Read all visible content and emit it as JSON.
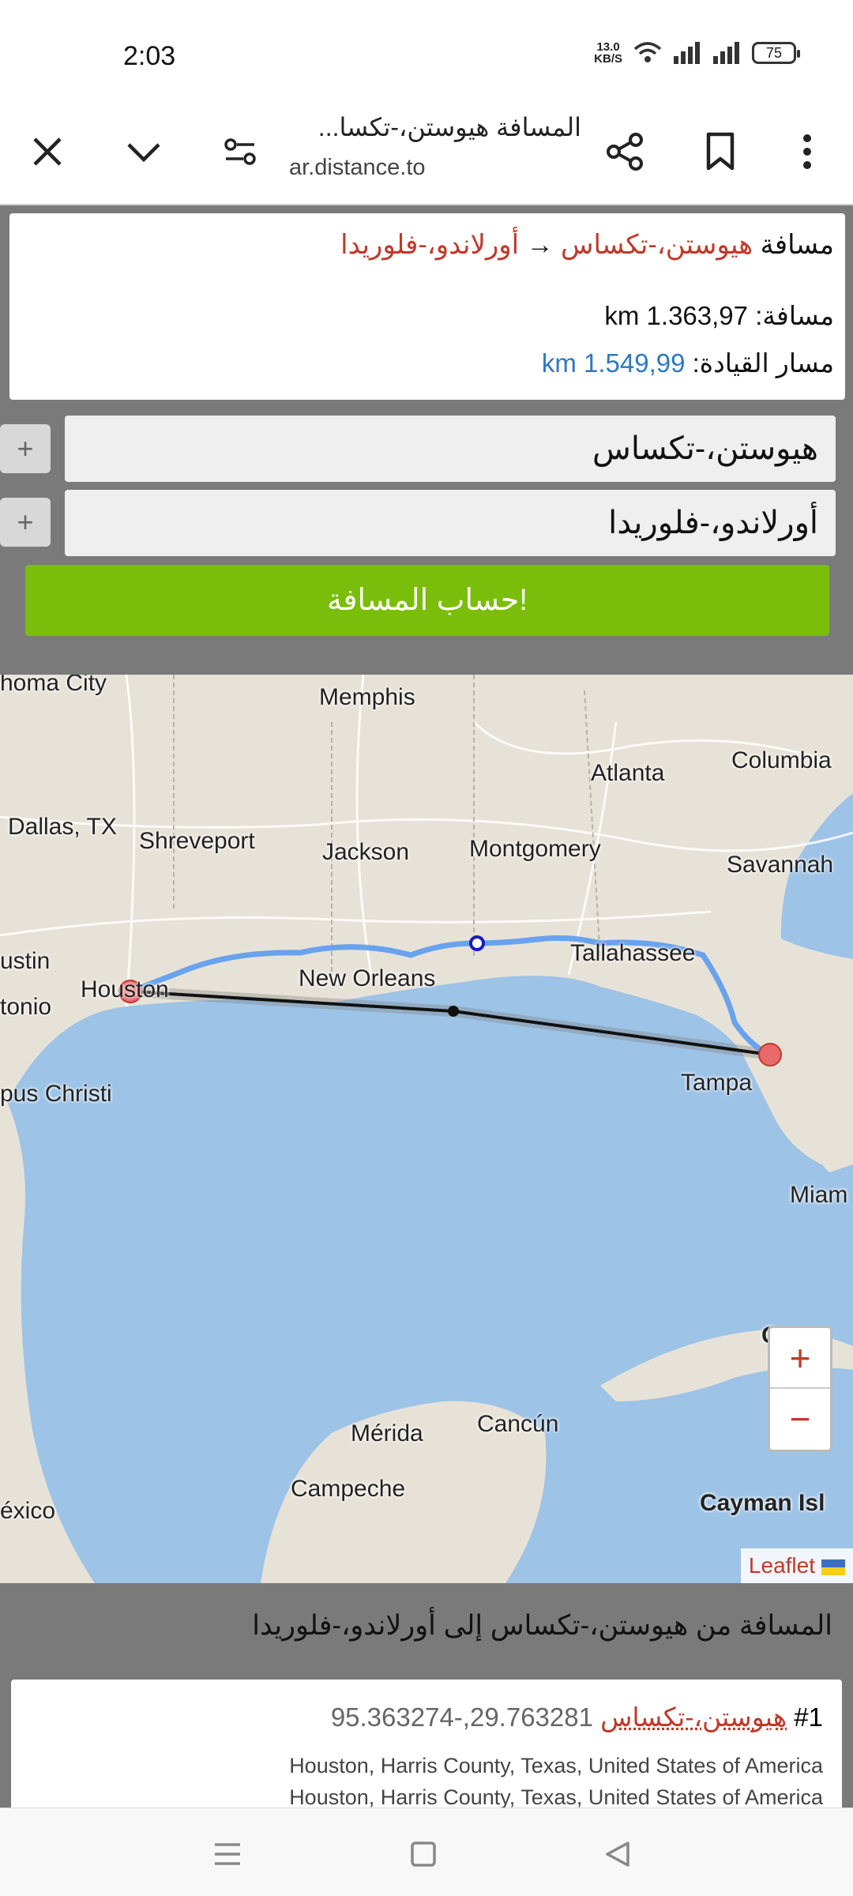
{
  "status": {
    "time": "2:03",
    "net_speed_value": "13.0",
    "net_speed_unit": "KB/S",
    "battery": "75"
  },
  "browser": {
    "title": "المسافة هيوستن،-تكسا...",
    "url": "ar.distance.to"
  },
  "summary": {
    "prefix": "مسافة",
    "from": "هيوستن،-تكساس",
    "arrow": "→",
    "to": "أورلاندو،-فلوريدا",
    "distance_label": "مسافة:",
    "distance_value": "km 1.363,97",
    "driving_label": "مسار القيادة:",
    "driving_value": "km 1.549,99"
  },
  "form": {
    "from_value": "هيوستن،-تكساس",
    "to_value": "أورلاندو،-فلوريدا",
    "plus": "+",
    "submit_label": "حساب المسافة!"
  },
  "map": {
    "labels": {
      "oklahoma": "homa City",
      "memphis": "Memphis",
      "atlanta": "Atlanta",
      "columbia": "Columbia",
      "dallas": "Dallas, TX",
      "shreveport": "Shreveport",
      "jackson": "Jackson",
      "montgomery": "Montgomery",
      "savannah": "Savannah",
      "austin": "ustin",
      "houston": "Houston",
      "new_orleans": "New Orleans",
      "tallahassee": "Tallahassee",
      "antonio": "tonio",
      "tampa": "Tampa",
      "corpus": "pus Christi",
      "miami": "Miam",
      "merida": "Mérida",
      "cancun": "Cancún",
      "campeche": "Campeche",
      "mexico": "éxico",
      "cayman": "Cayman Isl",
      "cuba_c": "C"
    },
    "zoom_in": "+",
    "zoom_out": "−",
    "attribution": "Leaflet"
  },
  "results": {
    "title": "المسافة من هيوستن،-تكساس إلى أورلاندو،-فلوريدا",
    "item1": {
      "num": "#1",
      "city": "هيوستن،-تكساس",
      "coords": "95.363274-,29.763281",
      "addr1": "Houston, Harris County, Texas, United States of America",
      "addr2": "Houston, Harris County, Texas, United States of America"
    }
  }
}
